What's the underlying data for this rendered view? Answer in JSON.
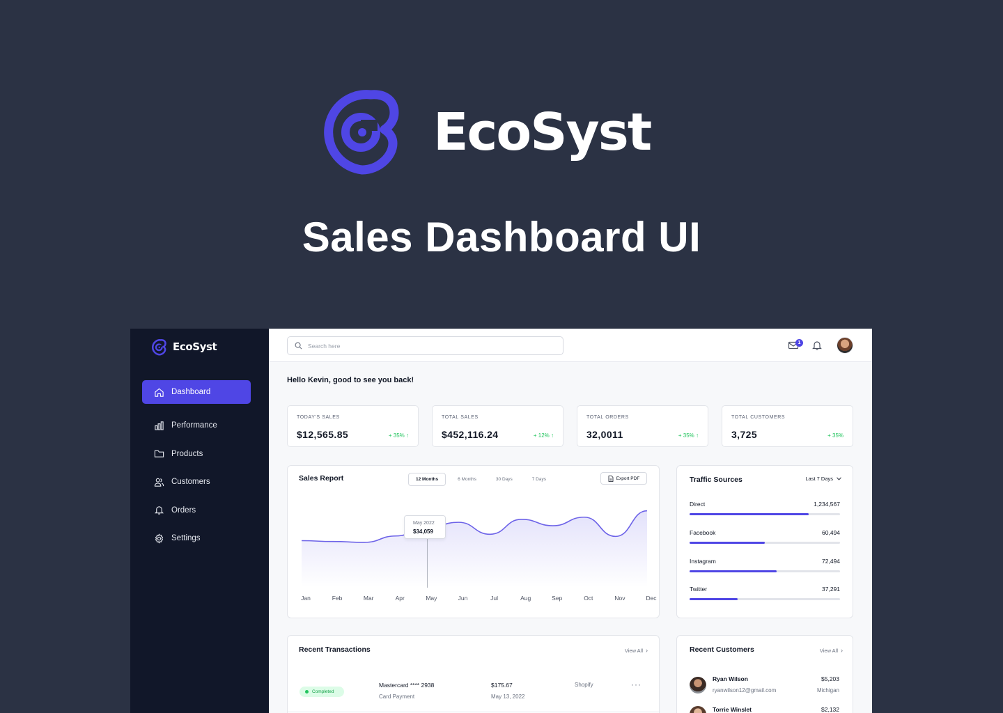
{
  "hero": {
    "brand": "EcoSyst",
    "subtitle": "Sales Dashboard UI"
  },
  "colors": {
    "accent": "#4f46e5",
    "background": "#2b3244",
    "sidebar": "#111729",
    "positive": "#22c55e"
  },
  "sidebar": {
    "brand": "EcoSyst",
    "items": [
      {
        "label": "Dashboard",
        "icon": "home-icon",
        "active": true
      },
      {
        "label": "Performance",
        "icon": "bar-chart-icon"
      },
      {
        "label": "Products",
        "icon": "folder-icon"
      },
      {
        "label": "Customers",
        "icon": "users-icon"
      },
      {
        "label": "Orders",
        "icon": "bell-icon"
      },
      {
        "label": "Settings",
        "icon": "gear-icon"
      }
    ]
  },
  "topbar": {
    "search_placeholder": "Search here",
    "mail_badge": "1"
  },
  "greeting": "Hello Kevin, good to see you back!",
  "stats": [
    {
      "label": "TODAY'S SALES",
      "value": "$12,565.85",
      "change": "+ 35% ↑"
    },
    {
      "label": "TOTAL SALES",
      "value": "$452,116.24",
      "change": "+ 12% ↑"
    },
    {
      "label": "TOTAL ORDERS",
      "value": "32,0011",
      "change": "+ 35% ↑"
    },
    {
      "label": "TOTAL CUSTOMERS",
      "value": "3,725",
      "change": "+ 35%"
    }
  ],
  "sales_report": {
    "title": "Sales Report",
    "tabs": [
      "12 Months",
      "6 Months",
      "30 Days",
      "7 Days"
    ],
    "export_label": "Export PDF",
    "tooltip_label": "May 2022",
    "tooltip_value": "$34,059"
  },
  "chart_data": {
    "type": "area",
    "title": "Sales Report",
    "x": [
      "Jan",
      "Feb",
      "Mar",
      "Apr",
      "May",
      "Jun",
      "Jul",
      "Aug",
      "Sep",
      "Oct",
      "Nov",
      "Dec"
    ],
    "series": [
      {
        "values": [
          31000,
          30800,
          30600,
          32100,
          34059,
          35300,
          32500,
          36000,
          34500,
          36500,
          32000,
          38000
        ]
      }
    ],
    "highlight": {
      "x": "May",
      "value": 34059
    },
    "ylim": [
      20000,
      42000
    ],
    "grid": false
  },
  "traffic": {
    "title": "Traffic Sources",
    "period": "Last 7 Days",
    "sources": [
      {
        "name": "Direct",
        "value": "1,234,567",
        "share": 0.79
      },
      {
        "name": "Facebook",
        "value": "60,494",
        "share": 0.5
      },
      {
        "name": "Instagram",
        "value": "72,494",
        "share": 0.58
      },
      {
        "name": "Twitter",
        "value": "37,291",
        "share": 0.32
      }
    ]
  },
  "transactions": {
    "title": "Recent Transactions",
    "view_all": "View All",
    "rows": [
      {
        "status": "Completed",
        "method": "Mastercard **** 2938",
        "type": "Card Payment",
        "amount": "$175.67",
        "date": "May 13, 2022",
        "store": "Shopify",
        "more": "···"
      }
    ]
  },
  "customers": {
    "title": "Recent Customers",
    "view_all": "View All",
    "rows": [
      {
        "name": "Ryan Wilson",
        "email": "ryanwilson12@gmail.com",
        "amount": "$5,203",
        "location": "Michigan"
      },
      {
        "name": "Torrie Winslet",
        "amount": "$2,132"
      }
    ]
  }
}
